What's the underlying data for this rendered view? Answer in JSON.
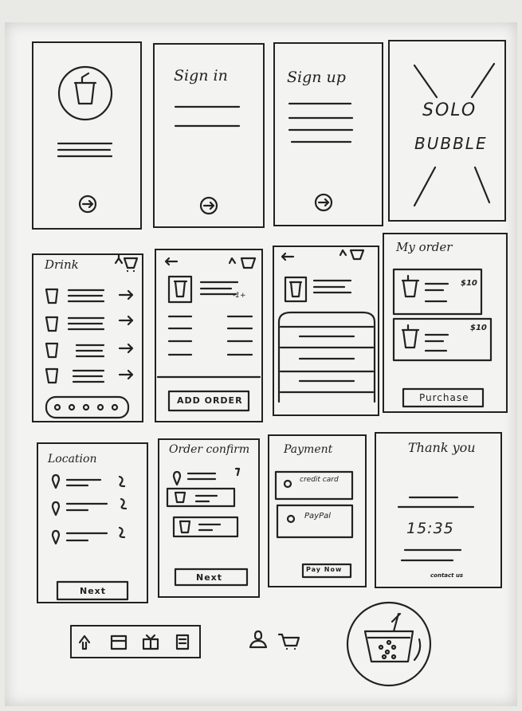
{
  "frames": {
    "sign_in": {
      "title": "Sign in"
    },
    "sign_up": {
      "title": "Sign up"
    },
    "splash": {
      "line1": "SOLO",
      "line2": "BUBBLE"
    },
    "drink": {
      "title": "Drink"
    },
    "add_order": {
      "button": "ADD ORDER",
      "qty": "-1+"
    },
    "my_order": {
      "title": "My order",
      "price1": "$10",
      "price2": "$10",
      "button": "Purchase"
    },
    "location": {
      "title": "Location",
      "button": "Next"
    },
    "order_confirm": {
      "title": "Order confirm",
      "button": "Next"
    },
    "payment": {
      "title": "Payment",
      "option1": "credit card",
      "option2": "PayPal",
      "button": "Pay Now"
    },
    "thank_you": {
      "title": "Thank you",
      "time": "15:35",
      "footer": "contact us"
    }
  },
  "bottom_nav": {
    "icons": [
      "home-icon",
      "store-icon",
      "gift-icon",
      "menu-icon"
    ],
    "extra_icons": [
      "profile-icon",
      "cart-icon"
    ]
  }
}
